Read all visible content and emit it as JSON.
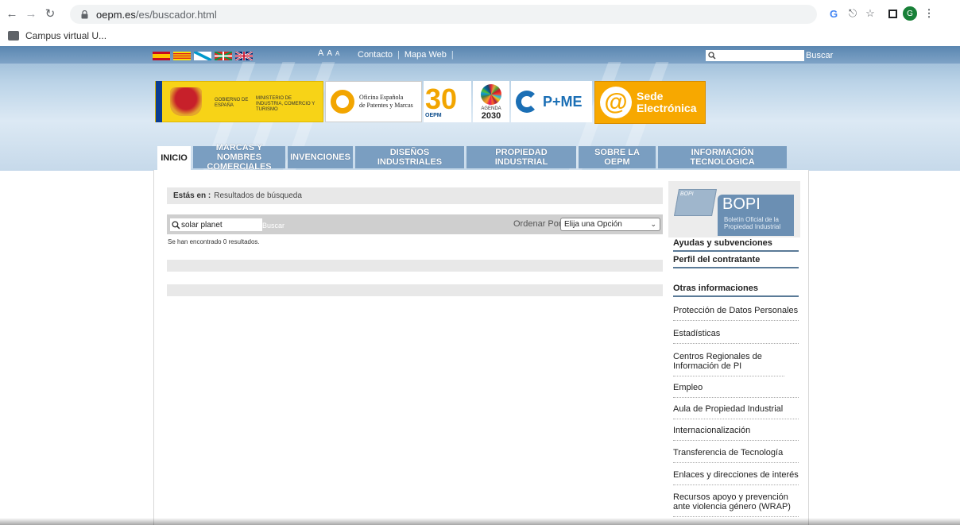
{
  "browser": {
    "url_host": "oepm.es",
    "url_path": "/es/buscador.html",
    "bookmark": "Campus virtual U...",
    "profile_initial": "G"
  },
  "header": {
    "font_controls": [
      "A",
      "A",
      "A"
    ],
    "top_links": [
      "Contacto",
      "Mapa Web"
    ],
    "search_button": "Buscar",
    "search_placeholder": "",
    "logos": {
      "gobierno": "GOBIERNO DE ESPAÑA",
      "ministerio": "MINISTERIO DE INDUSTRIA, COMERCIO Y TURISMO",
      "oepm_line1": "Oficina Española",
      "oepm_line2": "de Patentes y Marcas",
      "anniversary_num": "30",
      "anniversary_label": "OEPM",
      "agenda_label": "AGENDA",
      "agenda_year": "2030",
      "pyme": "P+ME",
      "sede_line1": "Sede",
      "sede_line2": "Electrónica"
    }
  },
  "nav": {
    "tabs": [
      {
        "label": "INICIO",
        "active": true
      },
      {
        "label": "MARCAS Y NOMBRES COMERCIALES"
      },
      {
        "label": "INVENCIONES"
      },
      {
        "label": "DISEÑOS INDUSTRIALES"
      },
      {
        "label": "PROPIEDAD INDUSTRIAL"
      },
      {
        "label": "SOBRE LA OEPM"
      },
      {
        "label": "INFORMACIÓN TECNOLÓGICA"
      }
    ]
  },
  "main": {
    "breadcrumb_label": "Estás en :",
    "breadcrumb_value": "Resultados de búsqueda",
    "search_value": "solar planet",
    "search_button": "Buscar",
    "order_label": "Ordenar Por:",
    "order_selected": "Elija una Opción",
    "results_text": "Se han encontrado 0 resultados."
  },
  "sidebar": {
    "bopi_title": "BOPI",
    "bopi_subtitle": "Boletín Oficial de la Propiedad Industrial",
    "bopi_book": "BOPI",
    "headings": [
      "Ayudas y subvenciones",
      "Perfil del contratante",
      "Otras informaciones"
    ],
    "links": [
      "Protección de Datos Personales",
      "Estadísticas",
      "Centros Regionales de Información de PI",
      "Empleo",
      "Aula de Propiedad Industrial",
      "Internacionalización",
      "Transferencia de Tecnología",
      "Enlaces y direcciones de interés",
      "Recursos apoyo y prevención ante violencia género (WRAP)"
    ]
  }
}
